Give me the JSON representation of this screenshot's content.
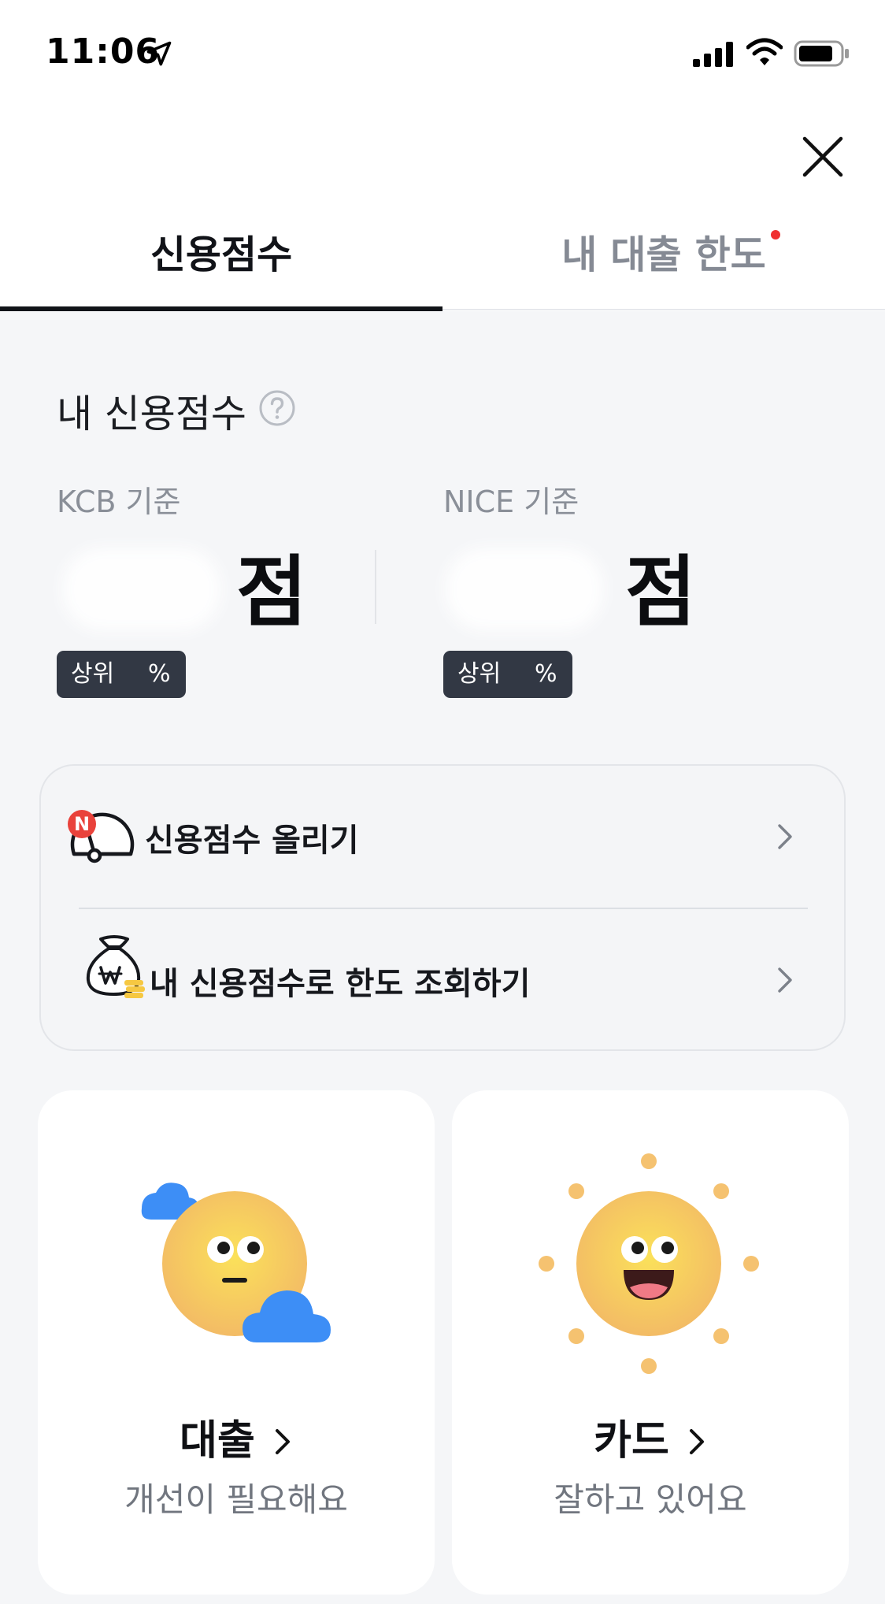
{
  "status_bar": {
    "time": "11:06",
    "icons": [
      "location-arrow-icon",
      "cellular-signal-icon",
      "wifi-icon",
      "battery-icon"
    ]
  },
  "header": {
    "close_icon": "close-icon"
  },
  "tabs": [
    {
      "label": "신용점수",
      "active": true
    },
    {
      "label": "내 대출 한도",
      "active": false,
      "has_new_dot": true
    }
  ],
  "score_section": {
    "title": "내 신용점수",
    "help_icon": "question-circle-icon",
    "bureaus": [
      {
        "label": "KCB 기준",
        "score_unit": "점",
        "rank_prefix": "상위",
        "rank_suffix": "%"
      },
      {
        "label": "NICE 기준",
        "score_unit": "점",
        "rank_prefix": "상위",
        "rank_suffix": "%"
      }
    ]
  },
  "actions": [
    {
      "label": "신용점수 올리기",
      "icon": "gauge-icon",
      "badge": "N"
    },
    {
      "label": "내 신용점수로 한도 조회하기",
      "icon": "money-bag-icon"
    }
  ],
  "grades": [
    {
      "title": "대출",
      "subtitle": "개선이 필요해요",
      "illustration": "cloudy-sun-face"
    },
    {
      "title": "카드",
      "subtitle": "잘하고 있어요",
      "illustration": "smiling-sun-face"
    }
  ],
  "colors": {
    "background": "#f5f6f8",
    "active_tab": "#111318",
    "inactive_tab": "#858a94",
    "new_dot": "#f0302f",
    "badge_bg": "#323844",
    "cloud_blue": "#3d8ef6",
    "sun_yellow": "#f5c659"
  }
}
